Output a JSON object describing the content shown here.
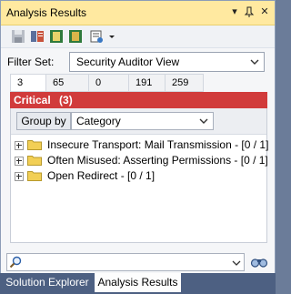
{
  "window": {
    "title": "Analysis Results",
    "controls": [
      "dropdown-icon",
      "pin-icon",
      "close-icon"
    ]
  },
  "toolbar": {
    "buttons": [
      "save-icon",
      "report-icon",
      "export-html-icon",
      "export-xml-icon",
      "settings-icon",
      "dropdown-icon"
    ]
  },
  "filter": {
    "label": "Filter Set:",
    "selected": "Security Auditor View"
  },
  "severity_tabs": [
    "3",
    "65",
    "0",
    "191",
    "259"
  ],
  "section": {
    "title": "Critical",
    "count": "(3)",
    "color": "#d13b3b"
  },
  "group_by": {
    "label": "Group by",
    "selected": "Category"
  },
  "tree_items": [
    {
      "label": "Insecure Transport: Mail Transmission - [0 / 1]"
    },
    {
      "label": "Often Misused: Asserting Permissions - [0 / 1]"
    },
    {
      "label": "Open Redirect - [0 / 1]"
    }
  ],
  "search": {
    "value": "",
    "placeholder": ""
  },
  "bottom_tabs": {
    "inactive": "Solution Explorer",
    "active": "Analysis Results"
  },
  "colors": {
    "title_bar": "#ffe9a0",
    "critical_header": "#d13b3b",
    "bottom_bar": "#4d6082",
    "folder": "#f2cf55"
  }
}
